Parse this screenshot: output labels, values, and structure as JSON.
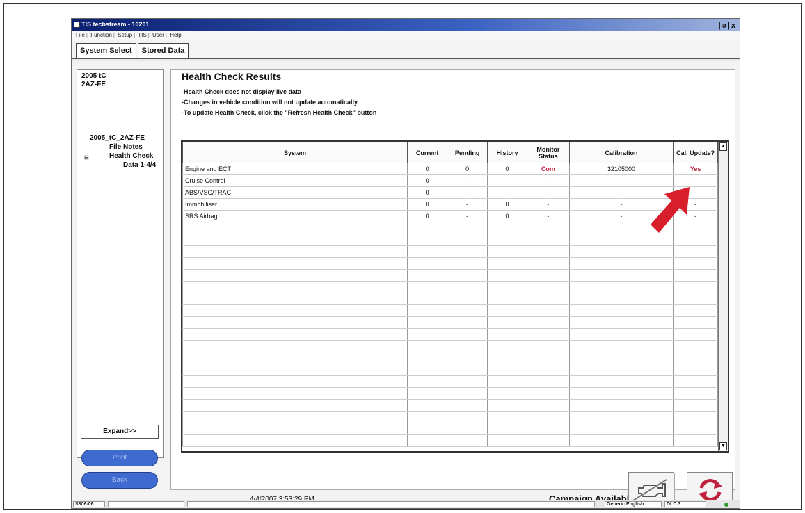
{
  "window": {
    "title": "TIS techstream - 10201",
    "controls": "_|ǝ|x"
  },
  "menu": [
    "File",
    "Function",
    "Setup",
    "TIS",
    "User",
    "Help"
  ],
  "tabs": [
    "System Select",
    "Stored Data"
  ],
  "sidebar": {
    "vehicle_line1": "2005 tC",
    "vehicle_line2": "2AZ-FE",
    "tree": {
      "root": "2005_tC_2AZ-FE",
      "file_notes": "File Notes",
      "health_check": "Health Check",
      "data_item": "Data 1-4/4"
    },
    "expand_label": "Expand>>",
    "button1_label": "Print",
    "button2_label": "Back"
  },
  "main": {
    "title": "Health Check Results",
    "notes": [
      "-Health Check does not display live data",
      "-Changes in vehicle condition will not update automatically",
      "-To update Health Check, click the \"Refresh Health Check\" button"
    ],
    "columns": [
      "System",
      "Current",
      "Pending",
      "History",
      "Monitor Status",
      "Calibration",
      "Cal. Update?"
    ],
    "rows": [
      {
        "system": "Engine and ECT",
        "current": "0",
        "pending": "0",
        "history": "0",
        "monitor": "Com",
        "calibration": "32105000",
        "cal_update": "Yes"
      },
      {
        "system": "Cruise Control",
        "current": "0",
        "pending": "-",
        "history": "-",
        "monitor": "-",
        "calibration": "-",
        "cal_update": "-"
      },
      {
        "system": "ABS/VSC/TRAC",
        "current": "0",
        "pending": "-",
        "history": "-",
        "monitor": "-",
        "calibration": "-",
        "cal_update": "-"
      },
      {
        "system": "Immobiliser",
        "current": "0",
        "pending": "-",
        "history": "0",
        "monitor": "-",
        "calibration": "-",
        "cal_update": "-"
      },
      {
        "system": "SRS Airbag",
        "current": "0",
        "pending": "-",
        "history": "0",
        "monitor": "-",
        "calibration": "-",
        "cal_update": "-"
      }
    ],
    "timestamp": "4/4/2007 3:53:29 PM",
    "campaign": "Campaign Available: NO"
  },
  "statusbar": {
    "left": "S306-06",
    "language": "Generic English",
    "connection": "DLC 3"
  },
  "colors": {
    "accent_red": "#c0213d",
    "title_blue": "#0a1f6e",
    "pill_blue": "#3f6bd0"
  },
  "icons": {
    "engine_button": "check-engine-icon",
    "refresh_button": "refresh-icon",
    "annotation": "red-arrow-icon"
  }
}
